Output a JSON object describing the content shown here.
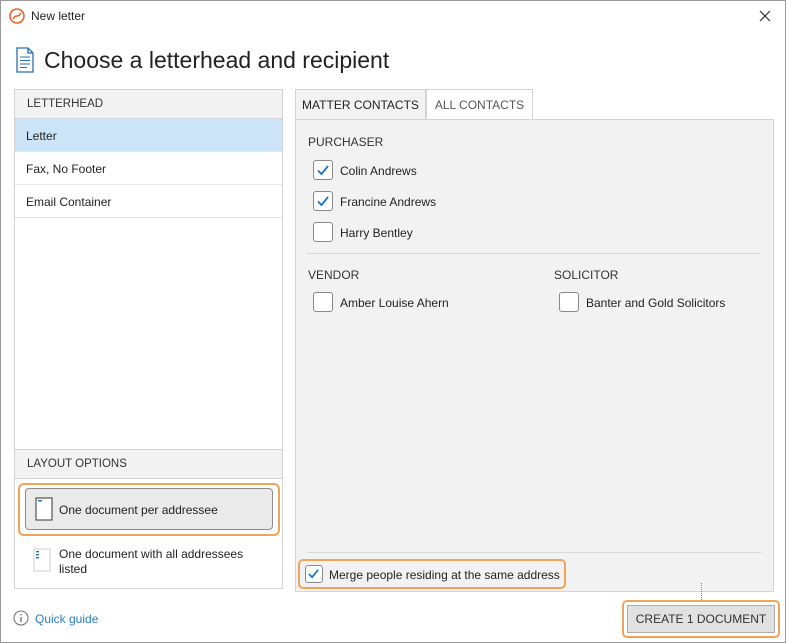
{
  "window": {
    "title": "New letter"
  },
  "page": {
    "title": "Choose a letterhead and recipient"
  },
  "letterhead": {
    "heading": "LETTERHEAD",
    "items": [
      {
        "label": "Letter",
        "selected": true
      },
      {
        "label": "Fax, No Footer",
        "selected": false
      },
      {
        "label": "Email Container",
        "selected": false
      }
    ]
  },
  "layout_options": {
    "heading": "LAYOUT OPTIONS",
    "options": [
      {
        "label": "One document per addressee",
        "selected": true
      },
      {
        "label_line1": "One document with all addressees",
        "label_line2": "listed",
        "selected": false
      }
    ]
  },
  "tabs": [
    {
      "label": "MATTER CONTACTS",
      "active": true
    },
    {
      "label": "ALL CONTACTS",
      "active": false
    }
  ],
  "groups": {
    "purchaser": {
      "label": "PURCHASER",
      "contacts": [
        {
          "name": "Colin Andrews",
          "checked": true
        },
        {
          "name": "Francine Andrews",
          "checked": true
        },
        {
          "name": "Harry Bentley",
          "checked": false
        }
      ]
    },
    "vendor": {
      "label": "VENDOR",
      "contacts": [
        {
          "name": "Amber Louise Ahern",
          "checked": false
        }
      ]
    },
    "solicitor": {
      "label": "SOLICITOR",
      "contacts": [
        {
          "name": "Banter and Gold Solicitors",
          "checked": false
        }
      ]
    }
  },
  "merge": {
    "label": "Merge people residing at the same address",
    "checked": true
  },
  "footer": {
    "help_label": "Quick guide",
    "create_label": "CREATE 1 DOCUMENT"
  },
  "colors": {
    "accent": "#f2a35a",
    "selection": "#cce4f7",
    "check": "#1a73c8",
    "link": "#2b7bbd",
    "logo": "#e8612c"
  },
  "icons": {
    "logo": "app-logo-icon",
    "close": "close-icon",
    "document": "document-icon",
    "info": "info-icon",
    "check": "checkmark-icon"
  }
}
